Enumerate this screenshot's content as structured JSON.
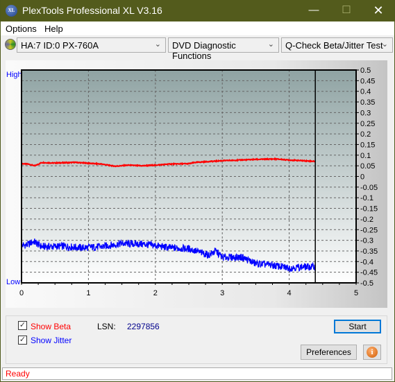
{
  "window": {
    "title": "PlexTools Professional XL V3.16",
    "logo_text": "XL"
  },
  "menu": [
    {
      "label": "Options"
    },
    {
      "label": "Help"
    }
  ],
  "toolbar": {
    "drive": "HA:7 ID:0  PX-760A",
    "function": "DVD Diagnostic Functions",
    "test": "Q-Check Beta/Jitter Test"
  },
  "chart": {
    "high_label": "High",
    "low_label": "Low"
  },
  "chart_data": {
    "type": "line",
    "xlim": [
      0,
      5
    ],
    "ylim": [
      -0.5,
      0.5
    ],
    "x_ticks": [
      "0",
      "1",
      "2",
      "3",
      "4",
      "5"
    ],
    "y_ticks": [
      "0.5",
      "0.45",
      "0.4",
      "0.35",
      "0.3",
      "0.25",
      "0.2",
      "0.15",
      "0.1",
      "0.05",
      "0",
      "-0.05",
      "-0.1",
      "-0.15",
      "-0.2",
      "-0.25",
      "-0.3",
      "-0.35",
      "-0.4",
      "-0.45",
      "-0.5"
    ],
    "grid": true,
    "end_marker_x": 4.39,
    "series": [
      {
        "name": "Beta",
        "color": "#ff0000",
        "points": [
          [
            0,
            0.06
          ],
          [
            0.1,
            0.058
          ],
          [
            0.2,
            0.05
          ],
          [
            0.3,
            0.065
          ],
          [
            0.5,
            0.063
          ],
          [
            0.8,
            0.066
          ],
          [
            1,
            0.062
          ],
          [
            1.2,
            0.058
          ],
          [
            1.4,
            0.048
          ],
          [
            1.6,
            0.053
          ],
          [
            1.8,
            0.05
          ],
          [
            2,
            0.053
          ],
          [
            2.2,
            0.058
          ],
          [
            2.5,
            0.06
          ],
          [
            2.6,
            0.066
          ],
          [
            2.8,
            0.07
          ],
          [
            3,
            0.074
          ],
          [
            3.2,
            0.076
          ],
          [
            3.5,
            0.08
          ],
          [
            3.8,
            0.082
          ],
          [
            4,
            0.077
          ],
          [
            4.2,
            0.074
          ],
          [
            4.39,
            0.071
          ]
        ]
      },
      {
        "name": "Jitter",
        "color": "#0000ff",
        "points": [
          [
            0,
            -0.325
          ],
          [
            0.1,
            -0.32
          ],
          [
            0.18,
            -0.305
          ],
          [
            0.3,
            -0.33
          ],
          [
            0.6,
            -0.328
          ],
          [
            0.9,
            -0.335
          ],
          [
            1.2,
            -0.33
          ],
          [
            1.5,
            -0.315
          ],
          [
            1.8,
            -0.318
          ],
          [
            2,
            -0.325
          ],
          [
            2.2,
            -0.335
          ],
          [
            2.5,
            -0.34
          ],
          [
            2.7,
            -0.36
          ],
          [
            2.8,
            -0.37
          ],
          [
            2.9,
            -0.35
          ],
          [
            3,
            -0.38
          ],
          [
            3.3,
            -0.38
          ],
          [
            3.5,
            -0.41
          ],
          [
            3.7,
            -0.415
          ],
          [
            4,
            -0.43
          ],
          [
            4.2,
            -0.425
          ],
          [
            4.39,
            -0.425
          ]
        ]
      }
    ]
  },
  "options": {
    "show_beta": "Show Beta",
    "show_beta_checked": true,
    "show_jitter": "Show Jitter",
    "show_jitter_checked": true,
    "lsn_label": "LSN:",
    "lsn_value": "2297856"
  },
  "buttons": {
    "start": "Start",
    "preferences": "Preferences",
    "info_icon": "info-icon"
  },
  "status": "Ready"
}
